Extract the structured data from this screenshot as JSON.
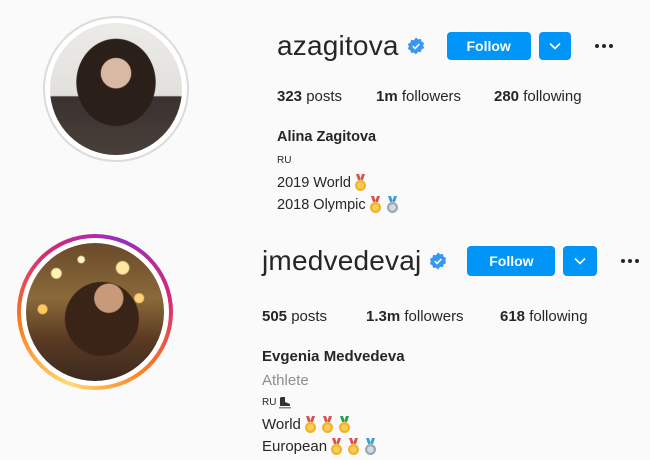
{
  "profiles": [
    {
      "username": "azagitova",
      "follow_label": "Follow",
      "stats": {
        "posts_count": "323",
        "posts_label": "posts",
        "followers_count": "1m",
        "followers_label": "followers",
        "following_count": "280",
        "following_label": "following"
      },
      "full_name": "Alina Zagitova",
      "country": "RU",
      "achievements": [
        {
          "text": "2019 World",
          "medals": [
            "gold-medal-icon"
          ]
        },
        {
          "text": "2018 Olympic",
          "medals": [
            "gold-medal-icon",
            "silver-medal-icon"
          ]
        }
      ],
      "story_ring": false
    },
    {
      "username": "jmedvedevaj",
      "follow_label": "Follow",
      "stats": {
        "posts_count": "505",
        "posts_label": "posts",
        "followers_count": "1.3m",
        "followers_label": "followers",
        "following_count": "618",
        "following_label": "following"
      },
      "full_name": "Evgenia Medvedeva",
      "category": "Athlete",
      "country": "RU",
      "country_icon": "ice-skate-icon",
      "achievements": [
        {
          "text": "World",
          "medals": [
            "gold-medal-icon",
            "gold-medal-icon",
            "gold-medal-icon"
          ]
        },
        {
          "text": "European",
          "medals": [
            "gold-medal-icon",
            "gold-medal-icon",
            "silver-medal-icon"
          ]
        }
      ],
      "story_ring": true
    }
  ],
  "colors": {
    "accent": "#0095f6",
    "verified": "#3897f0",
    "text": "#262626",
    "muted": "#8e8e8e",
    "gold": "#f0b429",
    "silver": "#b8c4cc"
  }
}
